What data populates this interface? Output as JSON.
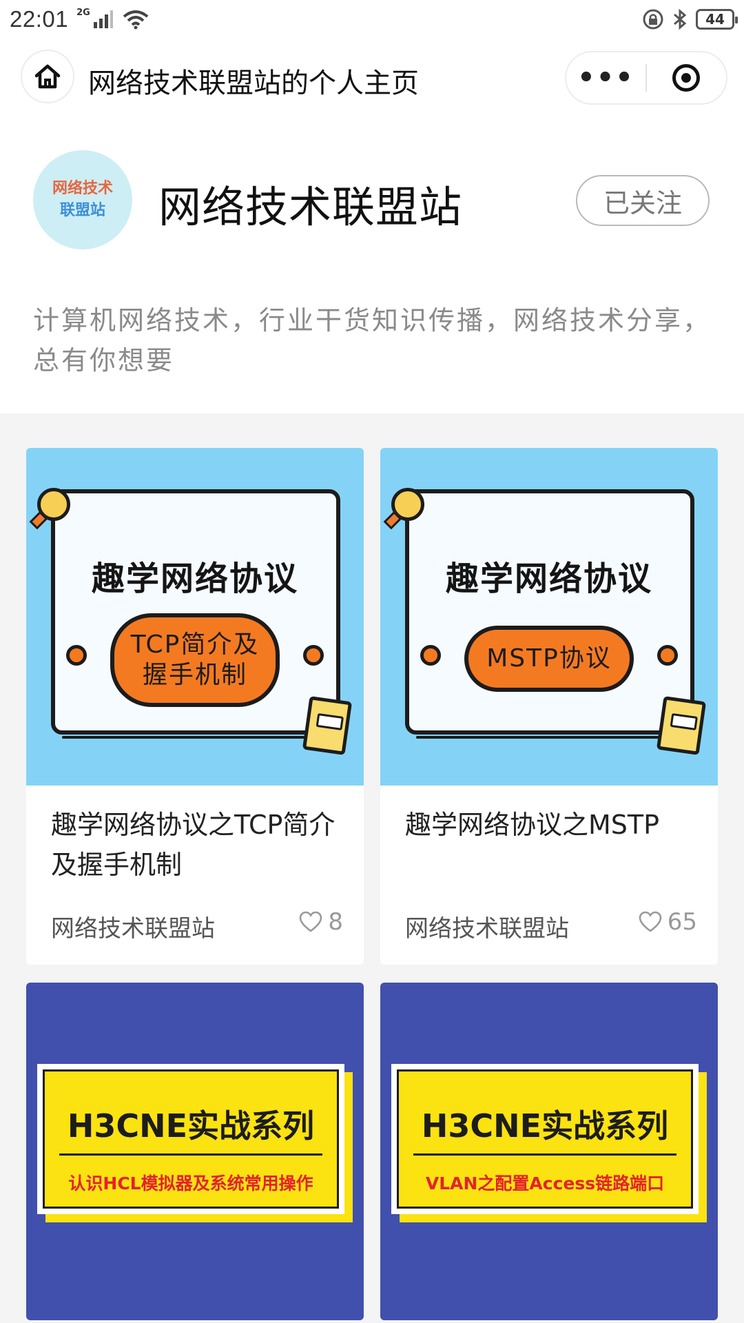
{
  "status_bar": {
    "time": "22:01",
    "network": "2G",
    "battery": "44"
  },
  "navbar": {
    "title": "网络技术联盟站的个人主页",
    "more_label": "•••"
  },
  "profile": {
    "avatar_line1": "网络技术",
    "avatar_line2": "联盟站",
    "name": "网络技术联盟站",
    "follow_label": "已关注",
    "bio": "计算机网络技术，行业干货知识传播，网络技术分享，总有你想要"
  },
  "articles": [
    {
      "cover_title": "趣学网络协议",
      "cover_pill_line1": "TCP简介及",
      "cover_pill_line2": "握手机制",
      "title": "趣学网络协议之TCP简介及握手机制",
      "author": "网络技术联盟站",
      "likes": "8"
    },
    {
      "cover_title": "趣学网络协议",
      "cover_pill_line1": "MSTP协议",
      "title": "趣学网络协议之MSTP",
      "author": "网络技术联盟站",
      "likes": "65"
    },
    {
      "cover_title": "H3CNE实战系列",
      "cover_subtitle": "认识HCL模拟器及系统常用操作"
    },
    {
      "cover_title": "H3CNE实战系列",
      "cover_subtitle": "VLAN之配置Access链路端口"
    }
  ],
  "colors": {
    "feed_background": "#f4f4f4",
    "cover_blue": "#84d3f6",
    "cover_indigo": "#4150ac",
    "accent_orange": "#f47a22",
    "banner_yellow": "#fbe211",
    "subtitle_red": "#e4222a"
  },
  "icons": [
    "home-icon",
    "more-icon",
    "close-target-icon",
    "heart-icon",
    "signal-icon",
    "wifi-icon",
    "bluetooth-icon",
    "lock-rotation-icon"
  ]
}
